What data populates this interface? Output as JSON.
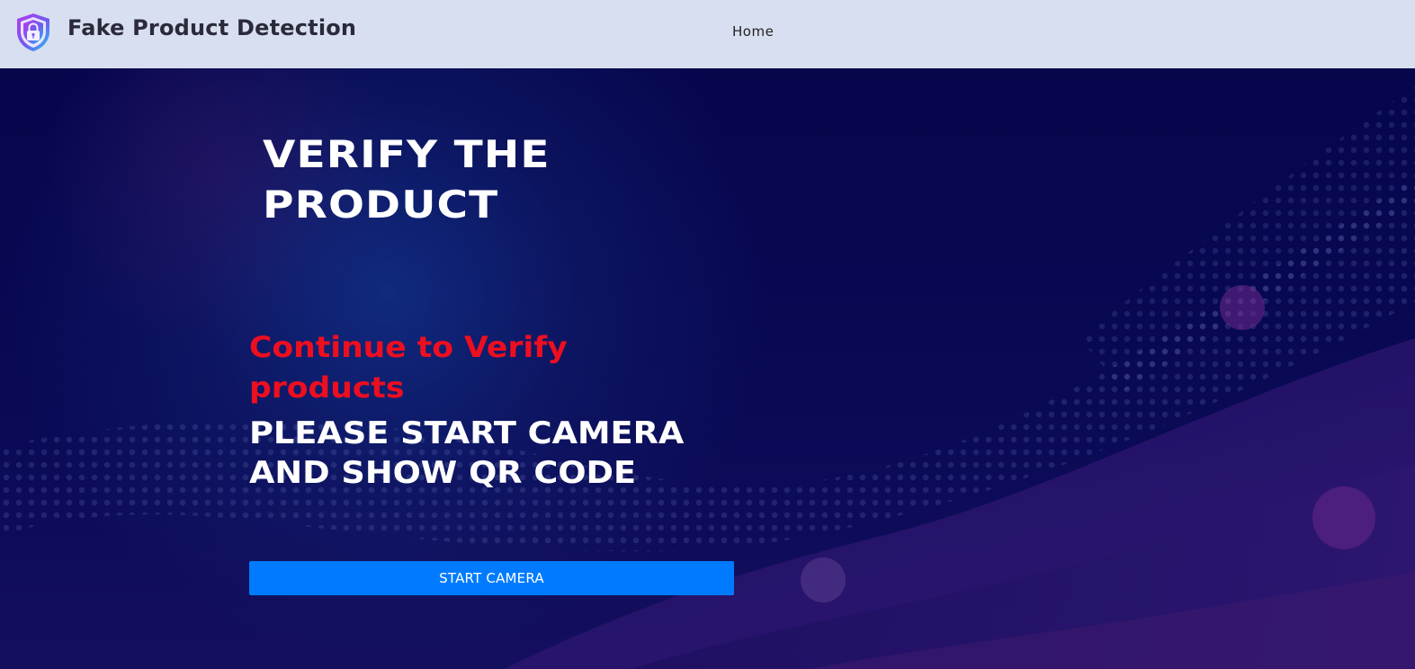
{
  "navbar": {
    "brand": "Fake Product Detection",
    "links": [
      "Home"
    ],
    "logo_icon": "shield-lock-icon"
  },
  "hero": {
    "title": "VERIFY THE PRODUCT",
    "subtitle": "Continue to Verify products",
    "instruction": "PLEASE START CAMERA AND SHOW QR CODE",
    "button_label": "START CAMERA"
  },
  "colors": {
    "navbar_bg": "#d8dff0",
    "hero_bg": "#07074a",
    "subtitle": "#ee0e1f",
    "button": "#007bff"
  }
}
